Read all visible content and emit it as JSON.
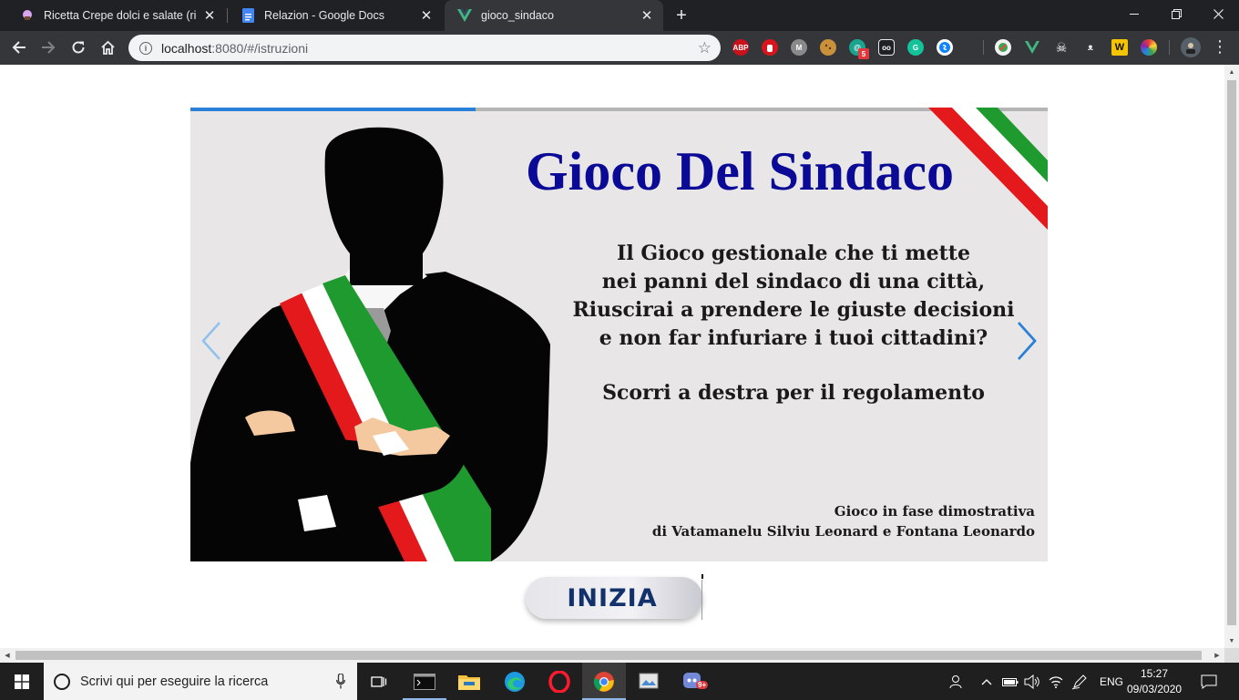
{
  "browser": {
    "tabs": [
      {
        "title": "Ricetta Crepe dolci e salate (ricett",
        "icon": "chef-hat-icon",
        "active": false
      },
      {
        "title": "Relazion - Google Docs",
        "icon": "google-docs-icon",
        "active": false
      },
      {
        "title": "gioco_sindaco",
        "icon": "vue-logo-icon",
        "active": true
      }
    ],
    "url_host": "localhost",
    "url_rest": ":8080/#/istruzioni",
    "extensions": [
      "ABP",
      "M",
      "G",
      "W"
    ]
  },
  "page": {
    "carousel": {
      "progress": 0.333,
      "title": "Gioco Del Sindaco",
      "body_lines": [
        "Il Gioco gestionale che ti mette",
        "nei panni del sindaco di una città,",
        "Riuscirai a prendere le giuste decisioni",
        "e non far infuriare i tuoi cittadini?"
      ],
      "cta": "Scorri a destra per il regolamento",
      "credits_lines": [
        "Gioco in fase dimostrativa",
        "di Vatamanelu Silviu Leonard e Fontana Leonardo"
      ],
      "colors": {
        "title": "#0a0a96",
        "progress": "#2a80d8",
        "arrow": "#2a80d8",
        "flag_green": "#1f9a2e",
        "flag_red": "#e3191c"
      }
    },
    "start_button": "INIZIA"
  },
  "taskbar": {
    "search_placeholder": "Scrivi qui per eseguire la ricerca",
    "language": "ENG",
    "time": "15:27",
    "date": "09/03/2020",
    "badge_count": "9+"
  }
}
